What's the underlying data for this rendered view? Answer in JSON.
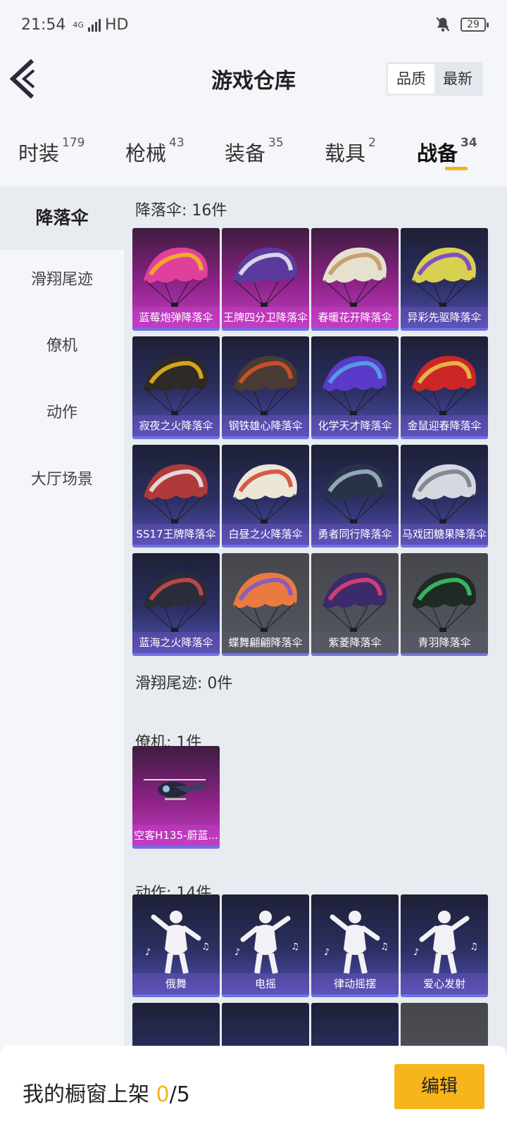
{
  "status": {
    "time": "21:54",
    "network": "4G",
    "hd": "HD",
    "battery": "29"
  },
  "header": {
    "title": "游戏仓库",
    "sort_quality": "品质",
    "sort_newest": "最新"
  },
  "categories": [
    {
      "label": "时装",
      "count": "179"
    },
    {
      "label": "枪械",
      "count": "43"
    },
    {
      "label": "装备",
      "count": "35"
    },
    {
      "label": "载具",
      "count": "2"
    },
    {
      "label": "战备",
      "count": "34"
    }
  ],
  "sidebar": [
    "降落伞",
    "滑翔尾迹",
    "僚机",
    "动作",
    "大厅场景"
  ],
  "sections": {
    "parachute": "降落伞: 16件",
    "trail": "滑翔尾迹: 0件",
    "wingman": "僚机: 1件",
    "emote": "动作: 14件"
  },
  "parachutes": [
    {
      "name": "蓝莓炮弹降落伞",
      "tier": "pink",
      "canopy": "#e0409c",
      "accent": "#f5b324"
    },
    {
      "name": "王牌四分卫降落伞",
      "tier": "pink",
      "canopy": "#5b3a9e",
      "accent": "#e6e6ef"
    },
    {
      "name": "春暖花开降落伞",
      "tier": "pink",
      "canopy": "#e6e0cf",
      "accent": "#c49a66"
    },
    {
      "name": "异彩先驱降落伞",
      "tier": "blue",
      "canopy": "#d8d050",
      "accent": "#7a3fd0"
    },
    {
      "name": "寂夜之火降落伞",
      "tier": "blue",
      "canopy": "#2e2a25",
      "accent": "#e5b21c"
    },
    {
      "name": "钢铁雄心降落伞",
      "tier": "blue",
      "canopy": "#4a3a34",
      "accent": "#d0532b"
    },
    {
      "name": "化学天才降落伞",
      "tier": "blue",
      "canopy": "#5a3ac8",
      "accent": "#57a3e3"
    },
    {
      "name": "金鼠迎春降落伞",
      "tier": "blue",
      "canopy": "#cc2626",
      "accent": "#e8c24a"
    },
    {
      "name": "SS17王牌降落伞",
      "tier": "blue",
      "canopy": "#b03a3a",
      "accent": "#e9e9e9"
    },
    {
      "name": "白昼之火降落伞",
      "tier": "blue",
      "canopy": "#ece6d6",
      "accent": "#d44b36"
    },
    {
      "name": "勇者同行降落伞",
      "tier": "blue",
      "canopy": "#283349",
      "accent": "#9fb4c8"
    },
    {
      "name": "马戏团糖果降落伞",
      "tier": "blue",
      "canopy": "#d6d8e0",
      "accent": "#7a7f8c"
    },
    {
      "name": "蓝海之火降落伞",
      "tier": "blue",
      "canopy": "#2a2c3a",
      "accent": "#c84a4a"
    },
    {
      "name": "蝶舞翩翩降落伞",
      "tier": "gray",
      "canopy": "#ea7a40",
      "accent": "#7d5ac8"
    },
    {
      "name": "紫菱降落伞",
      "tier": "gray",
      "canopy": "#3c2a6a",
      "accent": "#e04070"
    },
    {
      "name": "青羽降落伞",
      "tier": "gray",
      "canopy": "#1f2a24",
      "accent": "#35c46a"
    }
  ],
  "wingmen": [
    {
      "name": "空客H135-蔚蓝...",
      "tier": "pink"
    }
  ],
  "emotes": [
    {
      "name": "俄舞",
      "tier": "blue"
    },
    {
      "name": "电摇",
      "tier": "blue"
    },
    {
      "name": "律动摇摆",
      "tier": "blue"
    },
    {
      "name": "爱心发射",
      "tier": "blue"
    }
  ],
  "bottom": {
    "label": "我的橱窗上架 ",
    "current": "0",
    "total": "/5",
    "edit": "编辑"
  }
}
